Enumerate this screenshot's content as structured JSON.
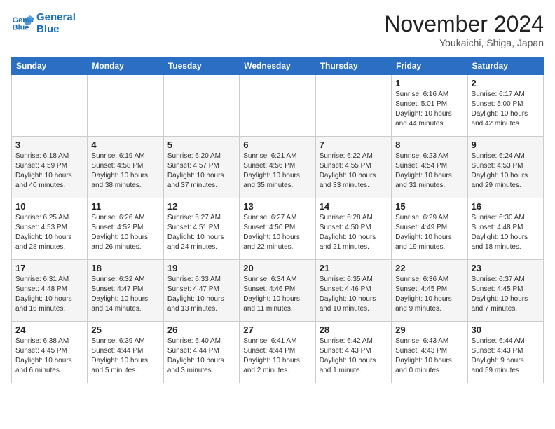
{
  "header": {
    "logo_line1": "General",
    "logo_line2": "Blue",
    "month_title": "November 2024",
    "location": "Youkaichi, Shiga, Japan"
  },
  "weekdays": [
    "Sunday",
    "Monday",
    "Tuesday",
    "Wednesday",
    "Thursday",
    "Friday",
    "Saturday"
  ],
  "weeks": [
    [
      {
        "day": "",
        "info": ""
      },
      {
        "day": "",
        "info": ""
      },
      {
        "day": "",
        "info": ""
      },
      {
        "day": "",
        "info": ""
      },
      {
        "day": "",
        "info": ""
      },
      {
        "day": "1",
        "info": "Sunrise: 6:16 AM\nSunset: 5:01 PM\nDaylight: 10 hours\nand 44 minutes."
      },
      {
        "day": "2",
        "info": "Sunrise: 6:17 AM\nSunset: 5:00 PM\nDaylight: 10 hours\nand 42 minutes."
      }
    ],
    [
      {
        "day": "3",
        "info": "Sunrise: 6:18 AM\nSunset: 4:59 PM\nDaylight: 10 hours\nand 40 minutes."
      },
      {
        "day": "4",
        "info": "Sunrise: 6:19 AM\nSunset: 4:58 PM\nDaylight: 10 hours\nand 38 minutes."
      },
      {
        "day": "5",
        "info": "Sunrise: 6:20 AM\nSunset: 4:57 PM\nDaylight: 10 hours\nand 37 minutes."
      },
      {
        "day": "6",
        "info": "Sunrise: 6:21 AM\nSunset: 4:56 PM\nDaylight: 10 hours\nand 35 minutes."
      },
      {
        "day": "7",
        "info": "Sunrise: 6:22 AM\nSunset: 4:55 PM\nDaylight: 10 hours\nand 33 minutes."
      },
      {
        "day": "8",
        "info": "Sunrise: 6:23 AM\nSunset: 4:54 PM\nDaylight: 10 hours\nand 31 minutes."
      },
      {
        "day": "9",
        "info": "Sunrise: 6:24 AM\nSunset: 4:53 PM\nDaylight: 10 hours\nand 29 minutes."
      }
    ],
    [
      {
        "day": "10",
        "info": "Sunrise: 6:25 AM\nSunset: 4:53 PM\nDaylight: 10 hours\nand 28 minutes."
      },
      {
        "day": "11",
        "info": "Sunrise: 6:26 AM\nSunset: 4:52 PM\nDaylight: 10 hours\nand 26 minutes."
      },
      {
        "day": "12",
        "info": "Sunrise: 6:27 AM\nSunset: 4:51 PM\nDaylight: 10 hours\nand 24 minutes."
      },
      {
        "day": "13",
        "info": "Sunrise: 6:27 AM\nSunset: 4:50 PM\nDaylight: 10 hours\nand 22 minutes."
      },
      {
        "day": "14",
        "info": "Sunrise: 6:28 AM\nSunset: 4:50 PM\nDaylight: 10 hours\nand 21 minutes."
      },
      {
        "day": "15",
        "info": "Sunrise: 6:29 AM\nSunset: 4:49 PM\nDaylight: 10 hours\nand 19 minutes."
      },
      {
        "day": "16",
        "info": "Sunrise: 6:30 AM\nSunset: 4:48 PM\nDaylight: 10 hours\nand 18 minutes."
      }
    ],
    [
      {
        "day": "17",
        "info": "Sunrise: 6:31 AM\nSunset: 4:48 PM\nDaylight: 10 hours\nand 16 minutes."
      },
      {
        "day": "18",
        "info": "Sunrise: 6:32 AM\nSunset: 4:47 PM\nDaylight: 10 hours\nand 14 minutes."
      },
      {
        "day": "19",
        "info": "Sunrise: 6:33 AM\nSunset: 4:47 PM\nDaylight: 10 hours\nand 13 minutes."
      },
      {
        "day": "20",
        "info": "Sunrise: 6:34 AM\nSunset: 4:46 PM\nDaylight: 10 hours\nand 11 minutes."
      },
      {
        "day": "21",
        "info": "Sunrise: 6:35 AM\nSunset: 4:46 PM\nDaylight: 10 hours\nand 10 minutes."
      },
      {
        "day": "22",
        "info": "Sunrise: 6:36 AM\nSunset: 4:45 PM\nDaylight: 10 hours\nand 9 minutes."
      },
      {
        "day": "23",
        "info": "Sunrise: 6:37 AM\nSunset: 4:45 PM\nDaylight: 10 hours\nand 7 minutes."
      }
    ],
    [
      {
        "day": "24",
        "info": "Sunrise: 6:38 AM\nSunset: 4:45 PM\nDaylight: 10 hours\nand 6 minutes."
      },
      {
        "day": "25",
        "info": "Sunrise: 6:39 AM\nSunset: 4:44 PM\nDaylight: 10 hours\nand 5 minutes."
      },
      {
        "day": "26",
        "info": "Sunrise: 6:40 AM\nSunset: 4:44 PM\nDaylight: 10 hours\nand 3 minutes."
      },
      {
        "day": "27",
        "info": "Sunrise: 6:41 AM\nSunset: 4:44 PM\nDaylight: 10 hours\nand 2 minutes."
      },
      {
        "day": "28",
        "info": "Sunrise: 6:42 AM\nSunset: 4:43 PM\nDaylight: 10 hours\nand 1 minute."
      },
      {
        "day": "29",
        "info": "Sunrise: 6:43 AM\nSunset: 4:43 PM\nDaylight: 10 hours\nand 0 minutes."
      },
      {
        "day": "30",
        "info": "Sunrise: 6:44 AM\nSunset: 4:43 PM\nDaylight: 9 hours\nand 59 minutes."
      }
    ]
  ]
}
